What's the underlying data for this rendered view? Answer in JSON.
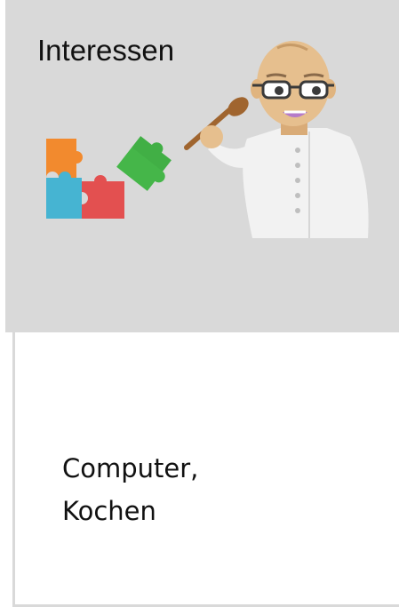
{
  "card": {
    "title": "Interessen",
    "lines": [
      "Computer,",
      "Kochen"
    ]
  },
  "icons": {
    "puzzle": "puzzle-pieces-icon",
    "person": "chef-with-spoon-illustration"
  },
  "colors": {
    "card_header": "#d9d9d9",
    "puzzle_orange": "#f28a2e",
    "puzzle_blue": "#46b4d2",
    "puzzle_red": "#e35050",
    "puzzle_green": "#45b649",
    "skin": "#e6bf8e",
    "coat": "#f2f2f2",
    "spoon": "#a0652f"
  }
}
